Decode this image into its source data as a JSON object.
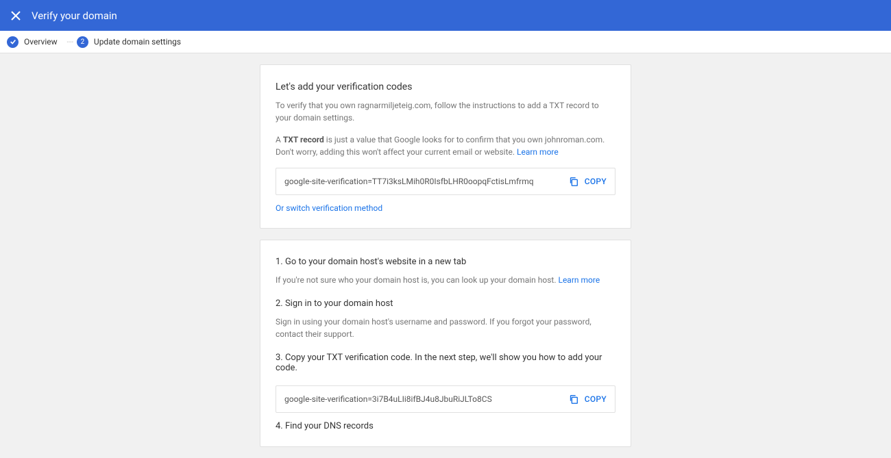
{
  "header": {
    "title": "Verify your domain"
  },
  "stepper": {
    "step1_label": "Overview",
    "step2_number": "2",
    "step2_label": "Update domain settings"
  },
  "card1": {
    "title": "Let's add your verification codes",
    "desc1": "To verify that you own ragnarmiljeteig.com, follow the instructions to add a TXT record to your domain settings.",
    "desc2_pre": "A ",
    "desc2_bold": "TXT record",
    "desc2_post": " is just a value that Google looks for to confirm that you own johnroman.com. Don't worry, adding this won't affect your current email or website. ",
    "learn_more": "Learn more",
    "code_value": "google-site-verification=TT7i3ksLMih0R0IsfbLHR0oopqFctisLmfrmq",
    "copy_label": "COPY",
    "switch_label": "Or switch verification method"
  },
  "card2": {
    "steps": [
      {
        "heading": "1. Go to your domain host's website in a new tab",
        "desc_pre": "If you're not sure who your domain host is, you can look up your domain host. ",
        "desc_link": "Learn more"
      },
      {
        "heading": "2. Sign in to your domain host",
        "desc_pre": "Sign in using your domain host's username and password. If you forgot your password, contact their support.",
        "desc_link": ""
      },
      {
        "heading": "3. Copy your TXT verification code. In the next step, we'll show you how to add your code.",
        "desc_pre": "",
        "desc_link": ""
      }
    ],
    "code_value": "google-site-verification=3i7B4uLIi8ifBJ4u8JbuRiJLTo8CS",
    "copy_label": "COPY",
    "step4_heading": "4. Find your DNS records"
  }
}
